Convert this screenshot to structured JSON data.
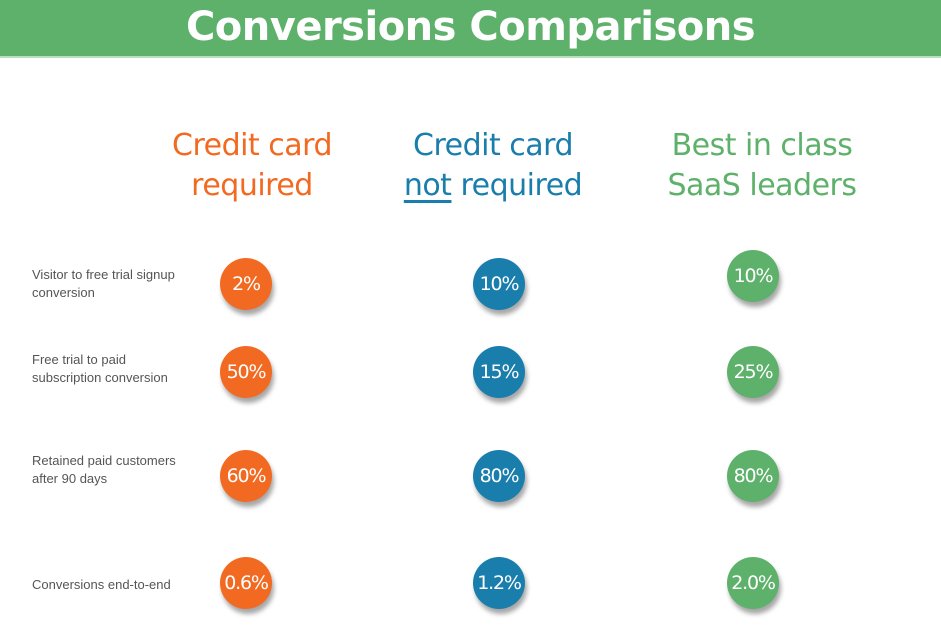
{
  "title": "Conversions Comparisons",
  "colors": {
    "banner": "#5eb16a",
    "credit_card_required": "#f26a21",
    "credit_card_not_required": "#1a7ead",
    "best_in_class": "#5eb16a",
    "label_text": "#555555"
  },
  "columns": [
    {
      "line1": "Credit card",
      "line2_pre": "",
      "line2_underlined": "",
      "line2": "required",
      "color": "#f26a21"
    },
    {
      "line1": "Credit card",
      "line2_pre": "",
      "line2_underlined": "not",
      "line2": " required",
      "color": "#1a7ead"
    },
    {
      "line1": "Best in class",
      "line2_pre": "",
      "line2_underlined": "",
      "line2": "SaaS leaders",
      "color": "#5eb16a"
    }
  ],
  "rows": [
    {
      "label": "Visitor to free trial signup conversion",
      "values": [
        "2%",
        "10%",
        "10%"
      ]
    },
    {
      "label": "Free trial to paid subscription conversion",
      "values": [
        "50%",
        "15%",
        "25%"
      ]
    },
    {
      "label": "Retained paid customers after 90 days",
      "values": [
        "60%",
        "80%",
        "80%"
      ]
    },
    {
      "label": "Conversions end-to-end",
      "values": [
        "0.6%",
        "1.2%",
        "2.0%"
      ]
    }
  ]
}
